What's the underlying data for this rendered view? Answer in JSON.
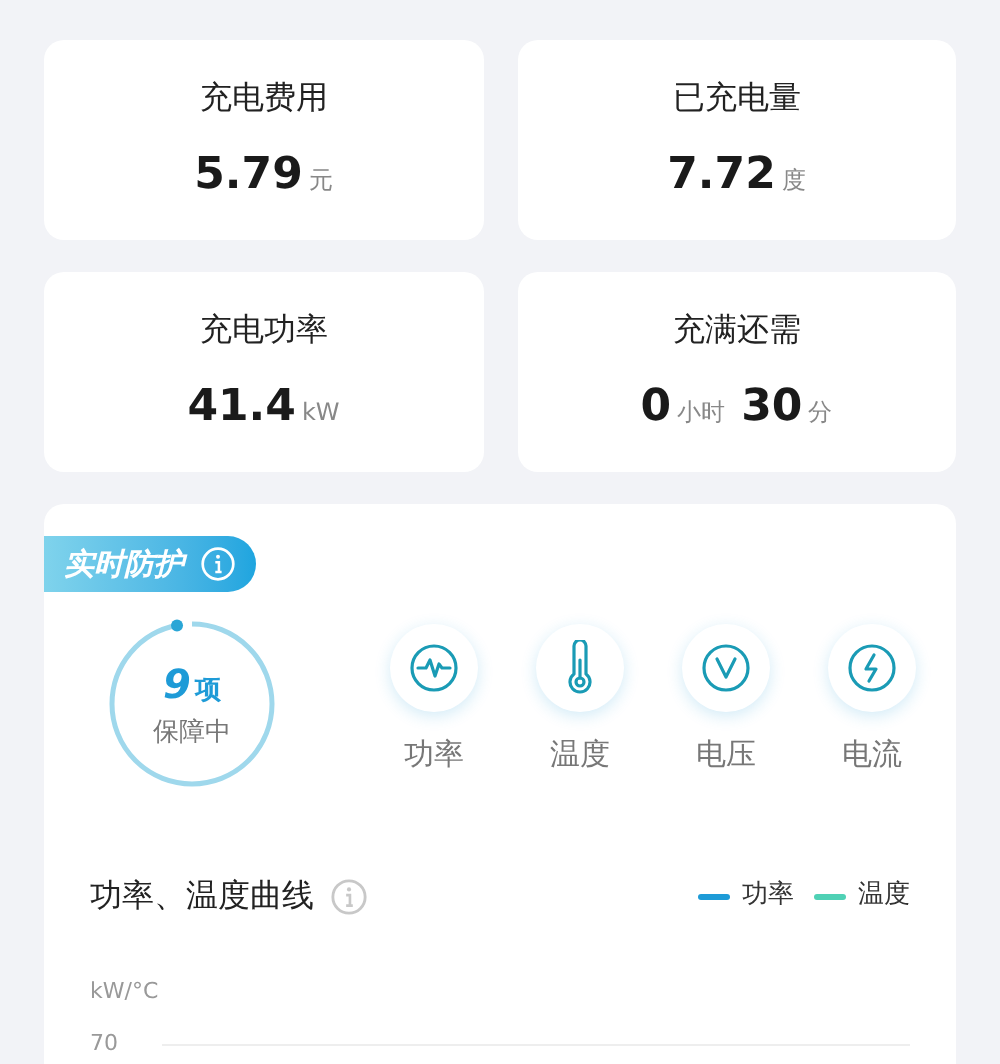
{
  "stats": [
    {
      "label": "充电费用",
      "parts": [
        {
          "value": "5.79",
          "unit": "元"
        }
      ]
    },
    {
      "label": "已充电量",
      "parts": [
        {
          "value": "7.72",
          "unit": "度"
        }
      ]
    },
    {
      "label": "充电功率",
      "parts": [
        {
          "value": "41.4",
          "unit": "kW"
        }
      ]
    },
    {
      "label": "充满还需",
      "parts": [
        {
          "value": "0",
          "unit": "小时"
        },
        {
          "value": "30",
          "unit": "分"
        }
      ]
    }
  ],
  "protection": {
    "badge": "实时防护",
    "count": "9",
    "count_unit": "项",
    "status": "保障中",
    "items": [
      {
        "kind": "power",
        "label": "功率"
      },
      {
        "kind": "temperature",
        "label": "温度"
      },
      {
        "kind": "voltage",
        "label": "电压"
      },
      {
        "kind": "current",
        "label": "电流"
      }
    ]
  },
  "chart": {
    "title": "功率、温度曲线",
    "legend": [
      {
        "label": "功率",
        "color": "#1e9bd7"
      },
      {
        "label": "温度",
        "color": "#4fd1b5"
      }
    ],
    "y_unit": "kW/°C",
    "top_tick": "70"
  }
}
